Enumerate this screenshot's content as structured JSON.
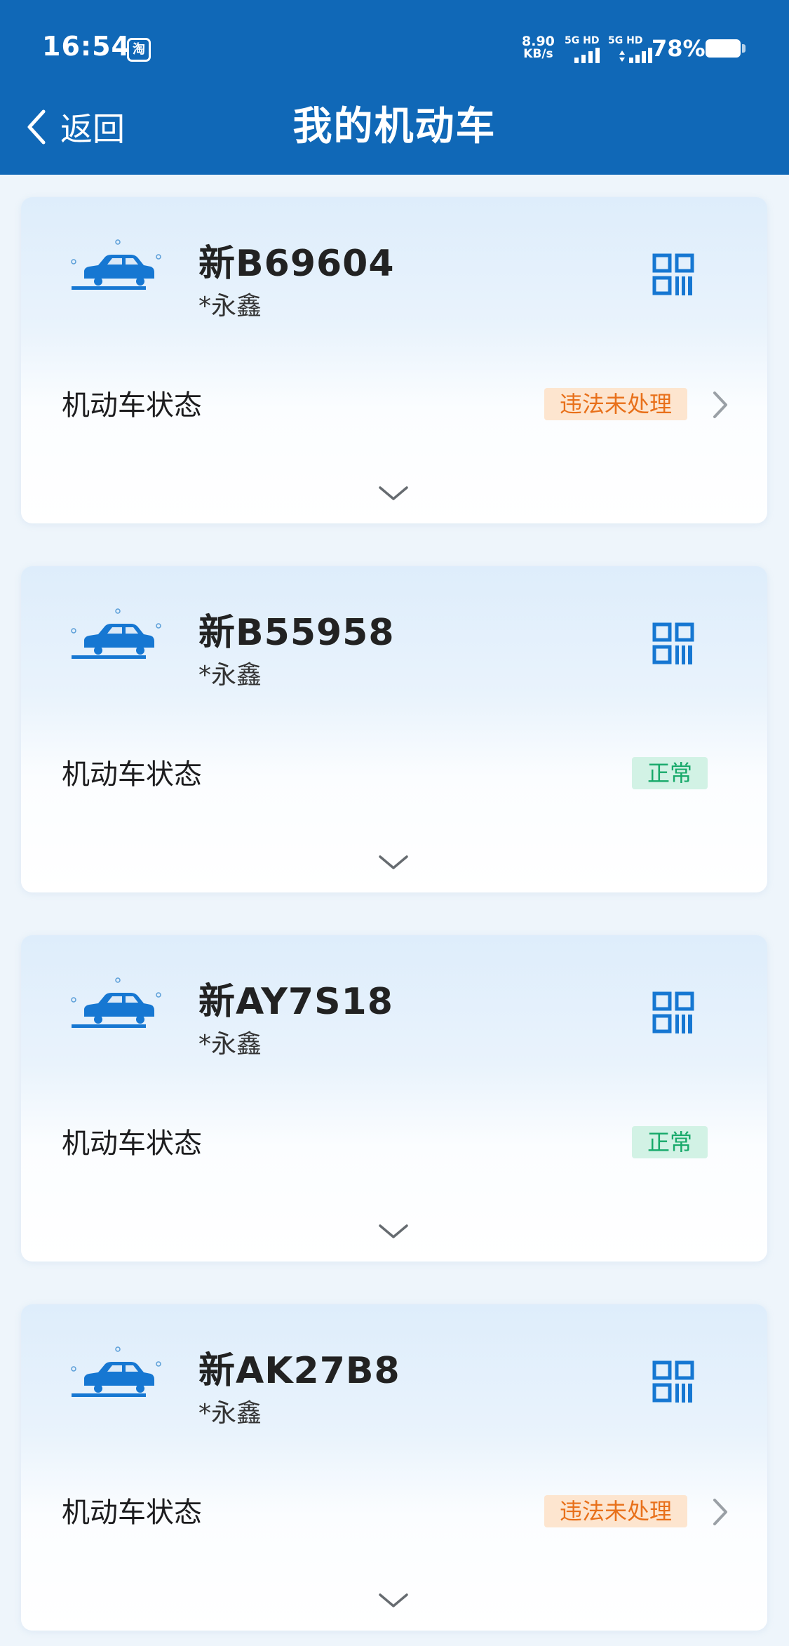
{
  "status_bar": {
    "time": "16:54",
    "notification_icon": "淘",
    "net_speed_value": "8.90",
    "net_speed_unit": "KB/s",
    "sim1_label": "5G HD",
    "sim2_label": "5G HD",
    "battery": "78%"
  },
  "header": {
    "back_label": "返回",
    "title": "我的机动车"
  },
  "vehicles": [
    {
      "plate": "新B69604",
      "owner": "*永鑫",
      "status_label": "机动车状态",
      "status": "违法未处理",
      "status_type": "warning"
    },
    {
      "plate": "新B55958",
      "owner": "*永鑫",
      "status_label": "机动车状态",
      "status": "正常",
      "status_type": "normal"
    },
    {
      "plate": "新AY7S18",
      "owner": "*永鑫",
      "status_label": "机动车状态",
      "status": "正常",
      "status_type": "normal"
    },
    {
      "plate": "新AK27B8",
      "owner": "*永鑫",
      "status_label": "机动车状态",
      "status": "违法未处理",
      "status_type": "warning"
    }
  ],
  "colors": {
    "header": "#1068b7",
    "accent_icon": "#1677d2",
    "warning_bg": "#fde5cf",
    "warning_text": "#e8701a",
    "normal_bg": "#d2f2e5",
    "normal_text": "#17a96a"
  },
  "icons": {
    "back": "chevron-left-icon",
    "vehicle": "car-icon",
    "qr": "qr-code-icon",
    "detail": "chevron-right-icon",
    "expand": "chevron-down-icon"
  }
}
